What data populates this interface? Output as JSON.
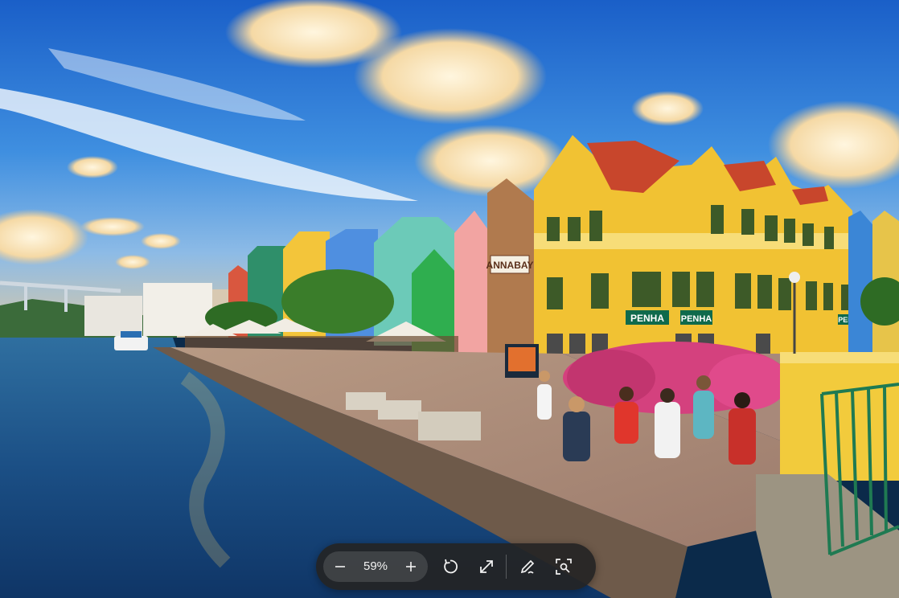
{
  "image": {
    "alt": "",
    "shop_signs": [
      "ANNABAY",
      "PENHA",
      "PENHA",
      "PENHA"
    ]
  },
  "toolbar": {
    "zoom_level": "59%",
    "icons": {
      "zoom_out": "minus-icon",
      "zoom_in": "plus-icon",
      "rotate": "rotate-icon",
      "fit": "expand-icon",
      "markup": "pen-icon",
      "visual_search": "scan-icon"
    }
  },
  "colors": {
    "toolbar_bg": "#242424",
    "toolbar_fg": "#f2f2f2"
  }
}
